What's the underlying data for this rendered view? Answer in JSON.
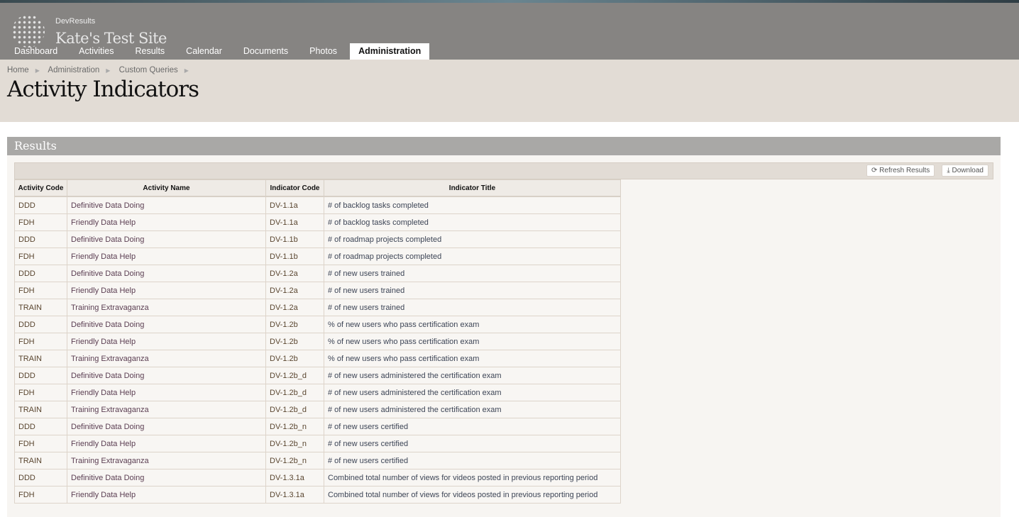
{
  "header": {
    "brand": "DevResults",
    "site_name": "Kate's Test Site"
  },
  "nav": [
    "Dashboard",
    "Activities",
    "Results",
    "Calendar",
    "Documents",
    "Photos",
    "Administration"
  ],
  "breadcrumbs": [
    "Home",
    "Administration",
    "Custom Queries"
  ],
  "page_title": "Activity Indicators",
  "panel": {
    "title": "Results",
    "refresh_label": "Refresh Results",
    "download_label": "Download"
  },
  "table": {
    "columns": [
      "Activity Code",
      "Activity Name",
      "Indicator Code",
      "Indicator Title"
    ],
    "rows": [
      [
        "DDD",
        "Definitive Data Doing",
        "DV-1.1a",
        "# of backlog tasks completed"
      ],
      [
        "FDH",
        "Friendly Data Help",
        "DV-1.1a",
        "# of backlog tasks completed"
      ],
      [
        "DDD",
        "Definitive Data Doing",
        "DV-1.1b",
        "# of roadmap projects completed"
      ],
      [
        "FDH",
        "Friendly Data Help",
        "DV-1.1b",
        "# of roadmap projects completed"
      ],
      [
        "DDD",
        "Definitive Data Doing",
        "DV-1.2a",
        "# of new users trained"
      ],
      [
        "FDH",
        "Friendly Data Help",
        "DV-1.2a",
        "# of new users trained"
      ],
      [
        "TRAIN",
        "Training Extravaganza",
        "DV-1.2a",
        "# of new users trained"
      ],
      [
        "DDD",
        "Definitive Data Doing",
        "DV-1.2b",
        "% of new users who pass certification exam"
      ],
      [
        "FDH",
        "Friendly Data Help",
        "DV-1.2b",
        "% of new users who pass certification exam"
      ],
      [
        "TRAIN",
        "Training Extravaganza",
        "DV-1.2b",
        "% of new users who pass certification exam"
      ],
      [
        "DDD",
        "Definitive Data Doing",
        "DV-1.2b_d",
        "# of new users administered the certification exam"
      ],
      [
        "FDH",
        "Friendly Data Help",
        "DV-1.2b_d",
        "# of new users administered the certification exam"
      ],
      [
        "TRAIN",
        "Training Extravaganza",
        "DV-1.2b_d",
        "# of new users administered the certification exam"
      ],
      [
        "DDD",
        "Definitive Data Doing",
        "DV-1.2b_n",
        "# of new users certified"
      ],
      [
        "FDH",
        "Friendly Data Help",
        "DV-1.2b_n",
        "# of new users certified"
      ],
      [
        "TRAIN",
        "Training Extravaganza",
        "DV-1.2b_n",
        "# of new users certified"
      ],
      [
        "DDD",
        "Definitive Data Doing",
        "DV-1.3.1a",
        "Combined total number of views for videos posted in previous reporting period"
      ],
      [
        "FDH",
        "Friendly Data Help",
        "DV-1.3.1a",
        "Combined total number of views for videos posted in previous reporting period"
      ]
    ]
  }
}
